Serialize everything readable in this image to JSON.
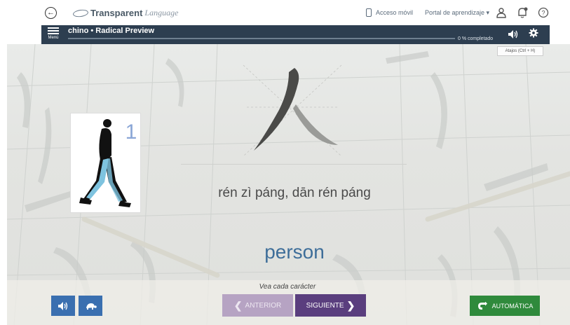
{
  "topbar": {
    "logo_bold": "Transparent",
    "logo_italic": "Language",
    "mobile_label": "Acceso móvil",
    "portal_label": "Portal de aprendizaje ▾"
  },
  "header": {
    "menu_label": "Menú",
    "title": "chino • Radical Preview",
    "progress_label": "0 % completado",
    "progress_fraction": 0
  },
  "shortcuts_label": "Atajos (Ctrl + H)",
  "lesson": {
    "character": "人",
    "picture_number": "1",
    "pinyin": "rén zì páng, dān rén páng",
    "meaning": "person"
  },
  "footer": {
    "hint": "Vea cada carácter",
    "prev_label": "ANTERIOR",
    "next_label": "SIGUIENTE",
    "auto_label": "AUTOMÁTICA"
  },
  "colors": {
    "header_bg": "#2d3e50",
    "prev_button": "#b6a3c3",
    "next_button": "#5a3e7e",
    "auto_button": "#2f8a3c",
    "audio_button": "#3a6fb0",
    "meaning_text": "#3e6e99"
  },
  "icons": [
    "back-icon",
    "phone-icon",
    "user-icon",
    "bell-icon",
    "help-icon",
    "menu-icon",
    "speaker-icon",
    "gear-icon",
    "turtle-icon",
    "chevron-left-icon",
    "chevron-right-icon",
    "repeat-icon"
  ]
}
